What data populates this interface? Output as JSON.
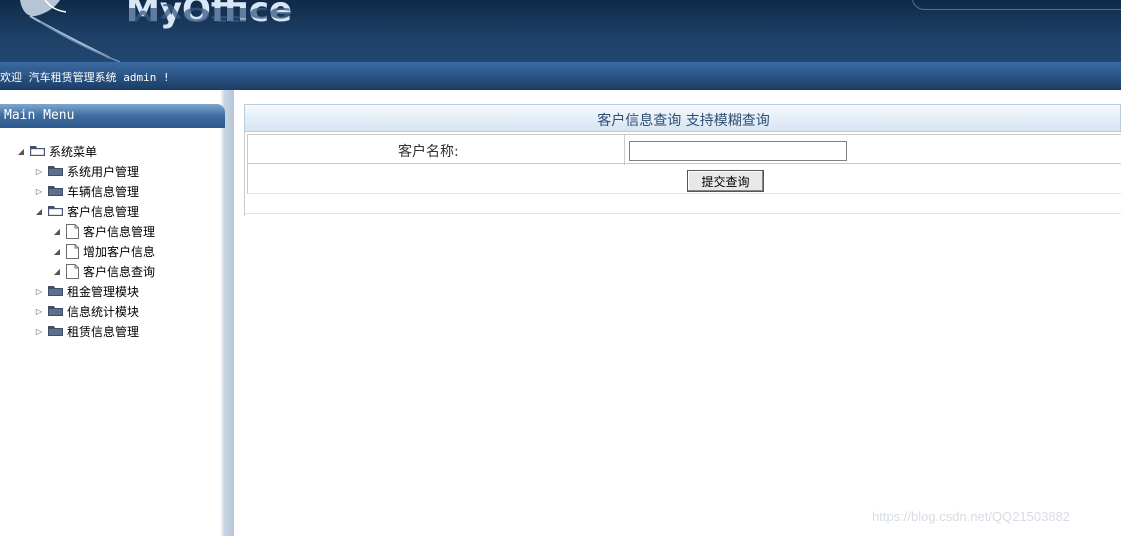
{
  "header": {
    "logo_text": "MyOffice"
  },
  "welcome": {
    "text": "欢迎 汽车租赁管理系统 admin !"
  },
  "sidebar": {
    "title": "Main Menu",
    "tree": [
      {
        "label": "系统菜单",
        "expanded": true,
        "icon": "folder-icon"
      },
      {
        "label": "系统用户管理",
        "expanded": false,
        "icon": "folder-icon"
      },
      {
        "label": "车辆信息管理",
        "expanded": false,
        "icon": "folder-icon"
      },
      {
        "label": "客户信息管理",
        "expanded": true,
        "icon": "folder-icon"
      },
      {
        "label": "客户信息管理",
        "icon": "document-icon"
      },
      {
        "label": "增加客户信息",
        "icon": "document-icon"
      },
      {
        "label": "客户信息查询",
        "icon": "document-icon"
      },
      {
        "label": "租金管理模块",
        "expanded": false,
        "icon": "folder-icon"
      },
      {
        "label": "信息统计模块",
        "expanded": false,
        "icon": "folder-icon"
      },
      {
        "label": "租赁信息管理",
        "expanded": false,
        "icon": "folder-icon"
      }
    ]
  },
  "main": {
    "title": "客户信息查询 支持模糊查询",
    "customer_name_label": "客户名称:",
    "customer_name_value": "",
    "submit_label": "提交查询"
  },
  "watermark": "https://blog.csdn.net/QQ21503882"
}
